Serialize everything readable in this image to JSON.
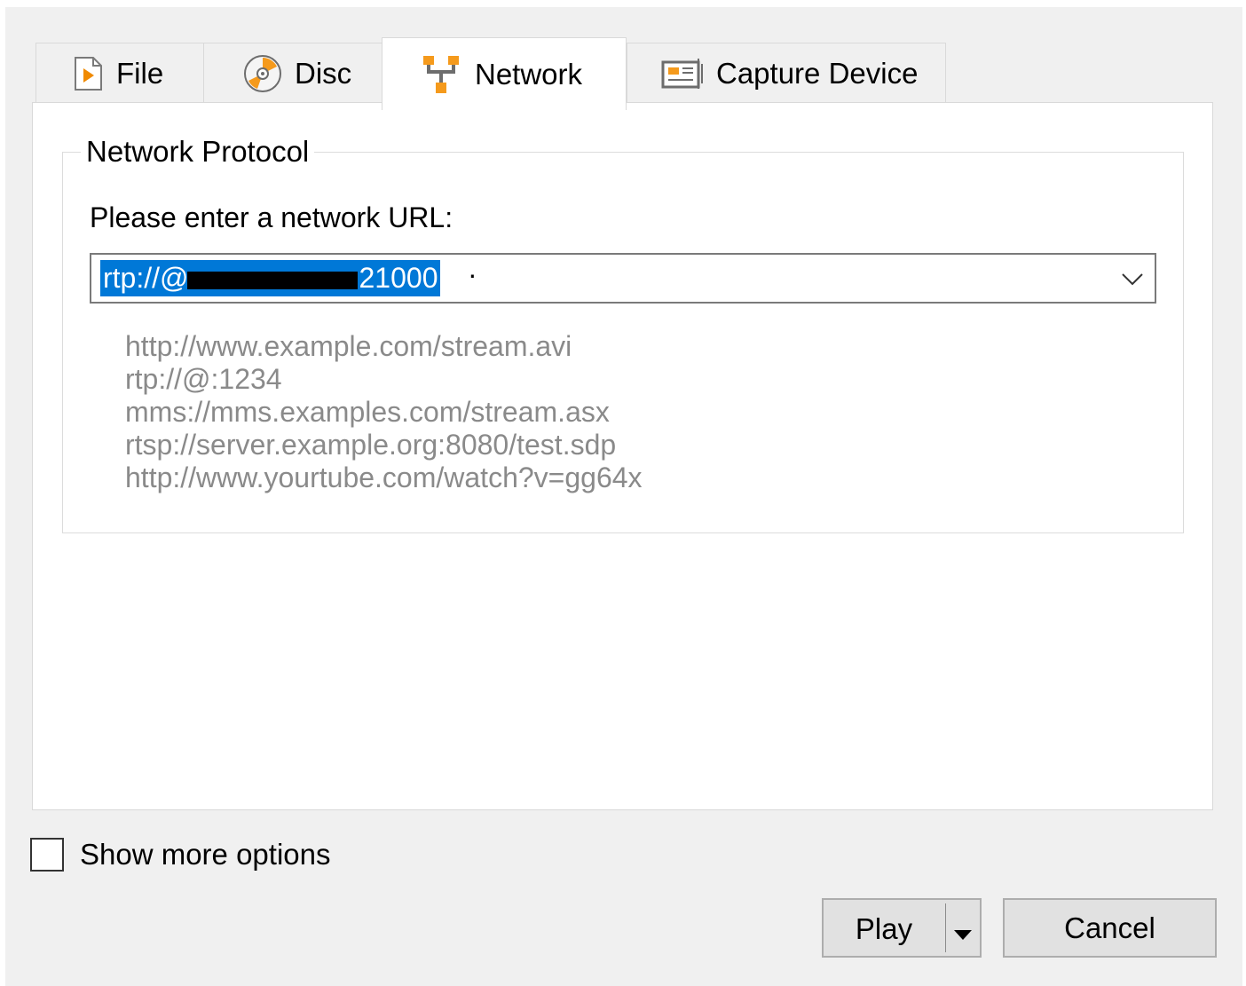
{
  "tabs": [
    {
      "label": "File",
      "icon": "file-icon"
    },
    {
      "label": "Disc",
      "icon": "disc-icon"
    },
    {
      "label": "Network",
      "icon": "network-icon"
    },
    {
      "label": "Capture Device",
      "icon": "capture-device-icon"
    }
  ],
  "active_tab": "Network",
  "network": {
    "group_title": "Network Protocol",
    "prompt": "Please enter a network URL:",
    "url_visible_start": "rtp://@",
    "url_visible_end": "21000",
    "examples": [
      "http://www.example.com/stream.avi",
      "rtp://@:1234",
      "mms://mms.examples.com/stream.asx",
      "rtsp://server.example.org:8080/test.sdp",
      "http://www.yourtube.com/watch?v=gg64x"
    ]
  },
  "show_more_options": {
    "label": "Show more options",
    "checked": false
  },
  "buttons": {
    "play": "Play",
    "cancel": "Cancel"
  },
  "colors": {
    "selection": "#0078d7",
    "example_text": "#8a8a8a",
    "background": "#f0f0f0"
  }
}
